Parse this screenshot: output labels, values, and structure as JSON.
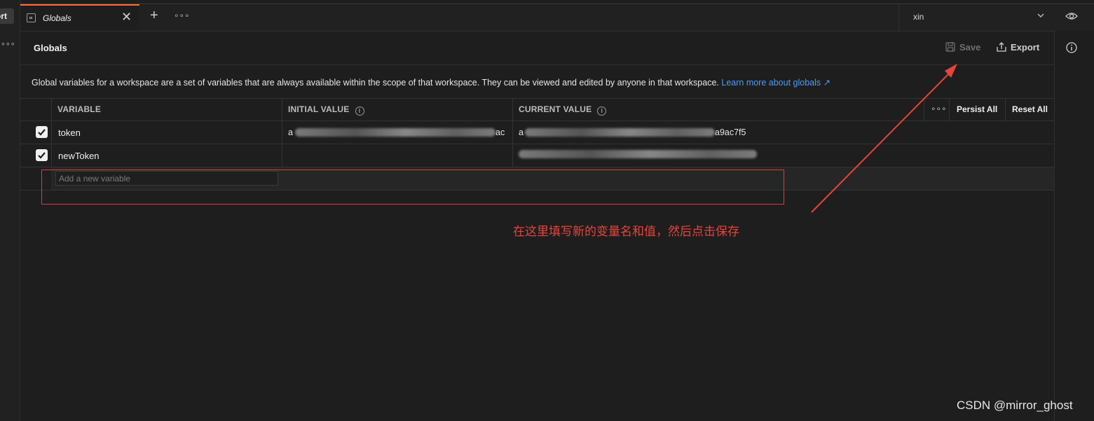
{
  "left_strip": {
    "button_text": "ort"
  },
  "tabs": {
    "active_label": "Globals"
  },
  "environment": {
    "name": "xin"
  },
  "header": {
    "title": "Globals",
    "save_label": "Save",
    "export_label": "Export"
  },
  "description": {
    "text": "Global variables for a workspace are a set of variables that are always available within the scope of that workspace. They can be viewed and edited by anyone in that workspace.",
    "link_text": "Learn more about globals ↗"
  },
  "table": {
    "columns": [
      "VARIABLE",
      "INITIAL VALUE",
      "CURRENT VALUE"
    ],
    "persist_all": "Persist All",
    "reset_all": "Reset All",
    "rows": [
      {
        "name": "token",
        "checked": true,
        "initial_value_visible": "a",
        "initial_value_tail": "ac",
        "current_value_visible": "a",
        "current_value_tail": "a9ac7f5"
      },
      {
        "name": "newToken",
        "checked": true
      }
    ],
    "new_variable_placeholder": "Add a new variable"
  },
  "annotation": {
    "text": "在这里填写新的变量名和值，然后点击保存",
    "color": "#e8443a"
  },
  "watermark": "CSDN @mirror_ghost",
  "colors": {
    "accent_tab": "#ff6c37",
    "link": "#4e9cf5",
    "highlight_box": "#e03a3a"
  },
  "icons": [
    "globe-tab-icon",
    "close-icon",
    "plus-icon",
    "more-icon",
    "chevron-down-icon",
    "eye-icon",
    "save-icon",
    "export-icon",
    "info-icon",
    "checkbox-checked-icon"
  ]
}
